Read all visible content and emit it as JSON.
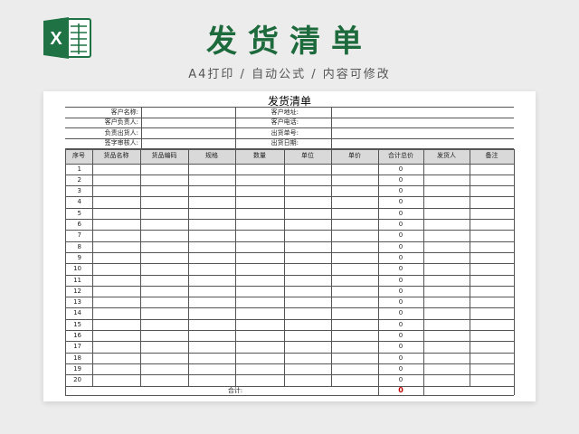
{
  "banner": {
    "logo_letter": "X",
    "title": "发货清单",
    "subtitle": "A4打印 / 自动公式 / 内容可修改"
  },
  "sheet": {
    "title": "发货清单",
    "info_left": [
      "客户名称:",
      "客户负责人:",
      "负责出货人:",
      "签字审核人:"
    ],
    "info_right": [
      "客户地址:",
      "客户电话:",
      "出货单号:",
      "出货日期:"
    ],
    "columns": [
      "序号",
      "货品名称",
      "货品编码",
      "规格",
      "数量",
      "单位",
      "单价",
      "合计总价",
      "发货人",
      "备注"
    ],
    "rows": [
      {
        "no": "1",
        "total": "0"
      },
      {
        "no": "2",
        "total": "0"
      },
      {
        "no": "3",
        "total": "0"
      },
      {
        "no": "4",
        "total": "0"
      },
      {
        "no": "5",
        "total": "0"
      },
      {
        "no": "6",
        "total": "0"
      },
      {
        "no": "7",
        "total": "0"
      },
      {
        "no": "8",
        "total": "0"
      },
      {
        "no": "9",
        "total": "0"
      },
      {
        "no": "10",
        "total": "0"
      },
      {
        "no": "11",
        "total": "0"
      },
      {
        "no": "12",
        "total": "0"
      },
      {
        "no": "13",
        "total": "0"
      },
      {
        "no": "14",
        "total": "0"
      },
      {
        "no": "15",
        "total": "0"
      },
      {
        "no": "16",
        "total": "0"
      },
      {
        "no": "17",
        "total": "0"
      },
      {
        "no": "18",
        "total": "0"
      },
      {
        "no": "19",
        "total": "0"
      },
      {
        "no": "20",
        "total": "0"
      }
    ],
    "sum_label": "合计:",
    "sum_value": "0"
  },
  "colors": {
    "brand_green": "#1d6a3c",
    "excel_green": "#1f7244",
    "header_gray": "#d9d9d9",
    "sum_red": "#c00000"
  },
  "icons": {
    "logo": "excel-icon"
  }
}
